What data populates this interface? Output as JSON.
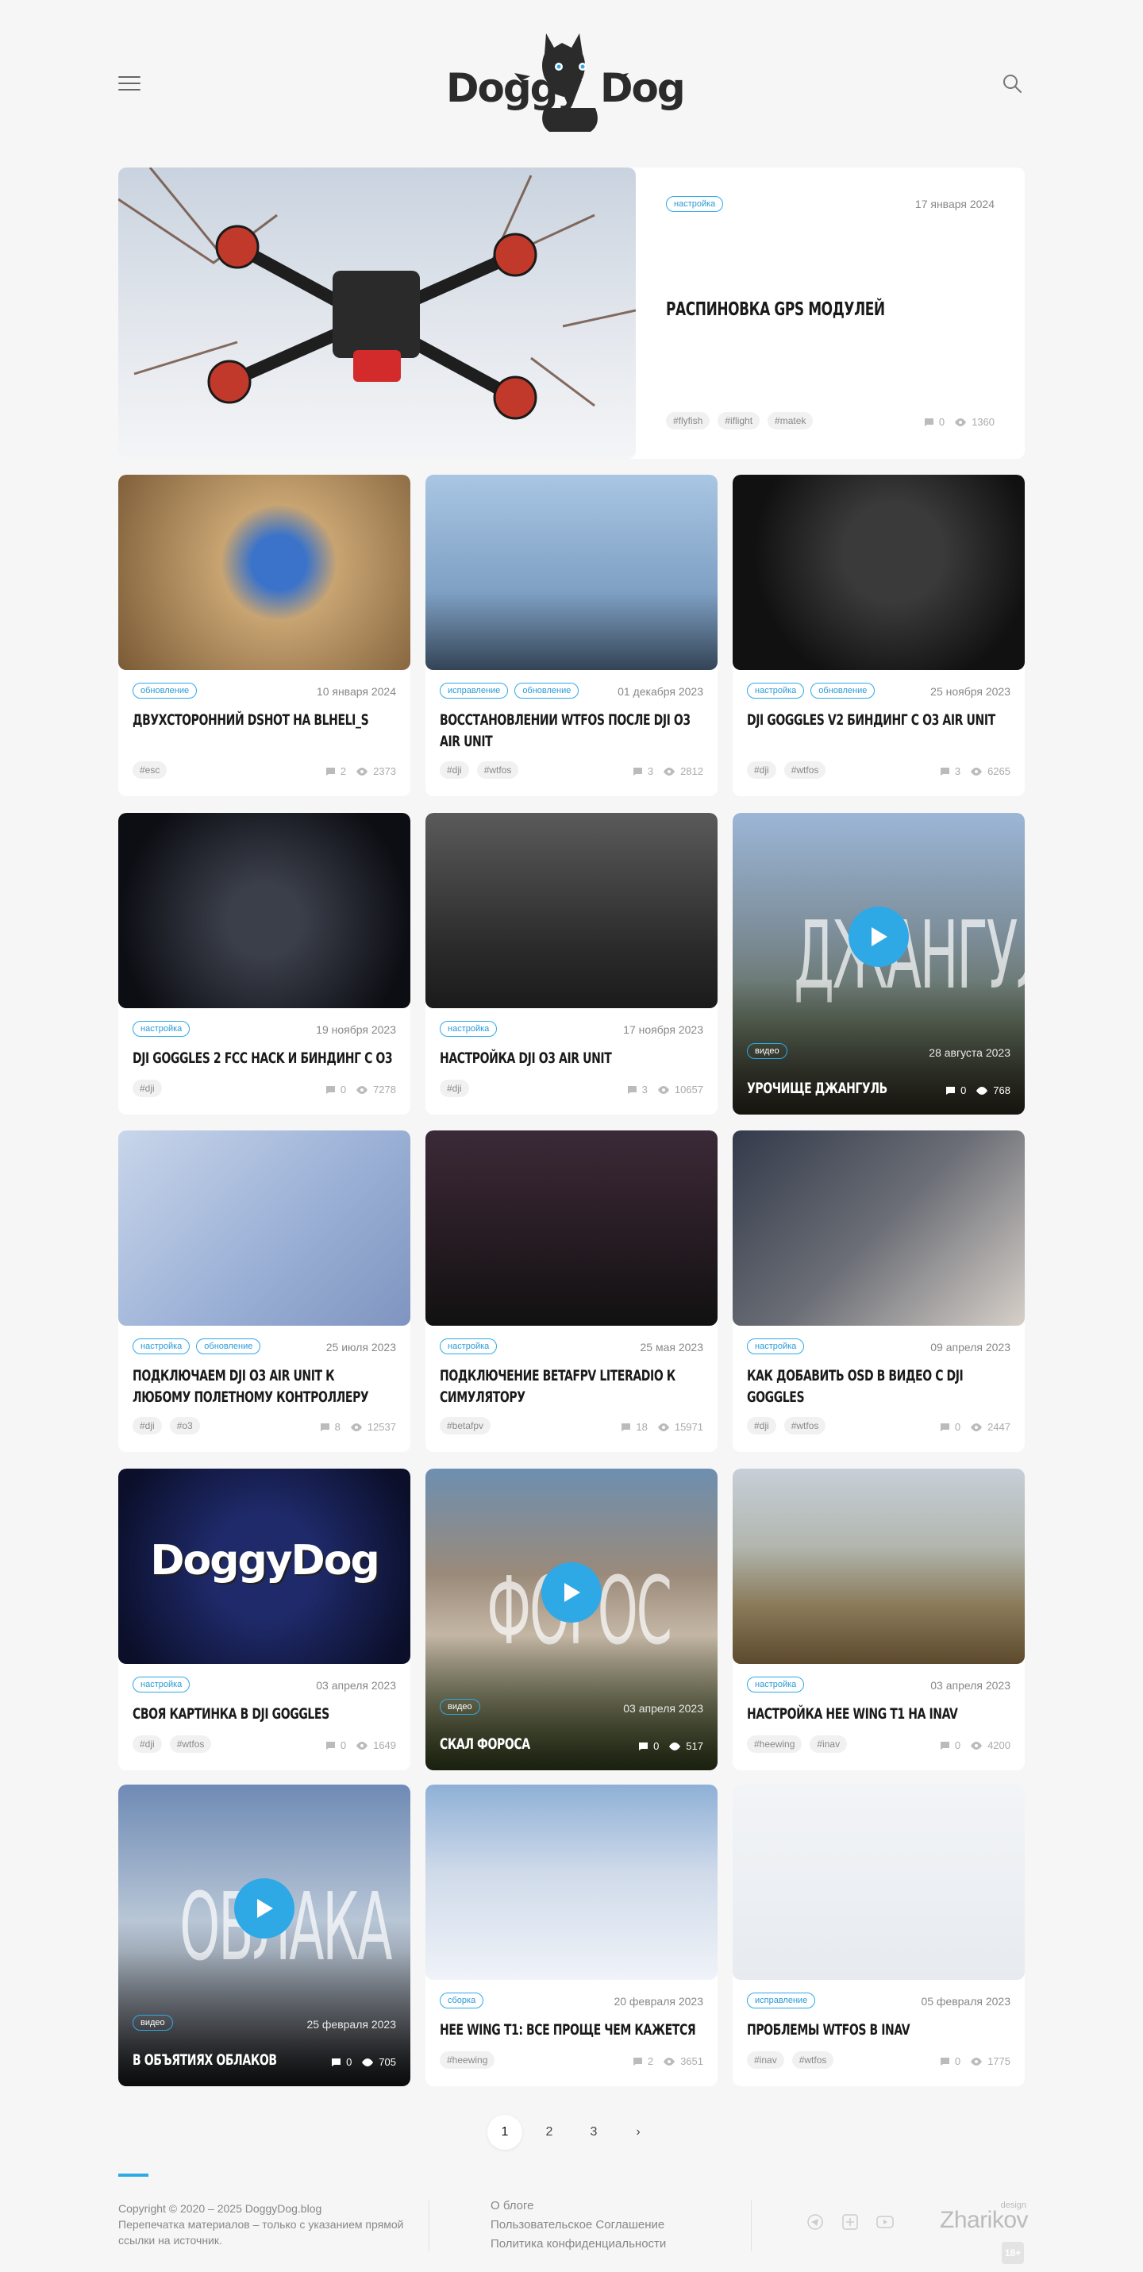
{
  "header": {
    "logo_text": "DoggyDog",
    "menu_icon": "hamburger-icon",
    "search_icon": "search-icon"
  },
  "colors": {
    "accent": "#2fa9e6",
    "background": "#f6f6f7"
  },
  "featured": {
    "category": "настройка",
    "date": "17 января 2024",
    "title": "Распиновка GPS модулей",
    "tags": [
      "#flyfish",
      "#iflight",
      "#matek"
    ],
    "comments": "0",
    "views": "1360"
  },
  "posts": [
    {
      "categories": [
        "обновление"
      ],
      "date": "10 января 2024",
      "title": "Двухсторонний Dshot на BLHeli_S",
      "tags": [
        "#esc"
      ],
      "comments": "2",
      "views": "2373"
    },
    {
      "categories": [
        "исправление",
        "обновление"
      ],
      "date": "01 декабря 2023",
      "title": "Восстановлении WTFOS после DJI O3 Air Unit",
      "tags": [
        "#dji",
        "#wtfos"
      ],
      "comments": "3",
      "views": "2812"
    },
    {
      "categories": [
        "настройка",
        "обновление"
      ],
      "date": "25 ноября 2023",
      "title": "DJI Goggles V2 биндинг с O3 Air Unit",
      "tags": [
        "#dji",
        "#wtfos"
      ],
      "comments": "3",
      "views": "6265"
    },
    {
      "categories": [
        "настройка"
      ],
      "date": "19 ноября 2023",
      "title": "DJI Goggles 2 FCC hack и биндинг с O3",
      "tags": [
        "#dji"
      ],
      "comments": "0",
      "views": "7278"
    },
    {
      "categories": [
        "настройка"
      ],
      "date": "17 ноября 2023",
      "title": "Настройка DJI O3 Air Unit",
      "tags": [
        "#dji"
      ],
      "comments": "3",
      "views": "10657"
    },
    {
      "categories": [
        "видео"
      ],
      "date": "28 августа 2023",
      "title": "Урочище Джангуль",
      "overlay_text": "ДЖАНГУЛ",
      "comments": "0",
      "views": "768"
    },
    {
      "categories": [
        "настройка",
        "обновление"
      ],
      "date": "25 июля 2023",
      "title": "Подключаем DJI O3 Air Unit к любому полетному контроллеру",
      "tags": [
        "#dji",
        "#o3"
      ],
      "comments": "8",
      "views": "12537"
    },
    {
      "categories": [
        "настройка"
      ],
      "date": "25 мая 2023",
      "title": "Подключение BetaFPV LiteRadio к симулятору",
      "tags": [
        "#betafpv"
      ],
      "comments": "18",
      "views": "15971"
    },
    {
      "categories": [
        "настройка"
      ],
      "date": "09 апреля 2023",
      "title": "Как добавить OSD в видео с DJI Goggles",
      "tags": [
        "#dji",
        "#wtfos"
      ],
      "comments": "0",
      "views": "2447"
    },
    {
      "categories": [
        "настройка"
      ],
      "date": "03 апреля 2023",
      "title": "Своя картинка в DJI Goggles",
      "tags": [
        "#dji",
        "#wtfos"
      ],
      "comments": "0",
      "views": "1649",
      "image_text": "DoggyDog"
    },
    {
      "categories": [
        "видео"
      ],
      "date": "03 апреля 2023",
      "title": "Скал Фороса",
      "overlay_text": "ФОРОС",
      "comments": "0",
      "views": "517"
    },
    {
      "categories": [
        "настройка"
      ],
      "date": "03 апреля 2023",
      "title": "Настройка Hee Wing T1 на INAV",
      "tags": [
        "#heewing",
        "#inav"
      ],
      "comments": "0",
      "views": "4200"
    },
    {
      "categories": [
        "видео"
      ],
      "date": "25 февраля 2023",
      "title": "В объятиях облаков",
      "overlay_text": "ОБЛАКА",
      "comments": "0",
      "views": "705"
    },
    {
      "categories": [
        "сборка"
      ],
      "date": "20 февраля 2023",
      "title": "Hee Wing T1: все проще чем кажется",
      "tags": [
        "#heewing"
      ],
      "comments": "2",
      "views": "3651"
    },
    {
      "categories": [
        "исправление"
      ],
      "date": "05 февраля 2023",
      "title": "Проблемы WTFOS в INAV",
      "tags": [
        "#inav",
        "#wtfos"
      ],
      "comments": "0",
      "views": "1775"
    }
  ],
  "pagination": {
    "pages": [
      "1",
      "2",
      "3"
    ],
    "next": "›",
    "current": "1"
  },
  "footer": {
    "copyright": "Copyright © 2020 – 2025 DoggyDog.blog",
    "notice": "Перепечатка материалов – только с указанием прямой ссылки на источник.",
    "links": [
      "О блоге",
      "Пользовательское Соглашение",
      "Политика конфиденциальности"
    ],
    "social_icons": [
      "telegram-icon",
      "plus-icon",
      "youtube-icon"
    ],
    "designer": "Zharikov",
    "designer_label": "design",
    "age_rating": "18+"
  }
}
